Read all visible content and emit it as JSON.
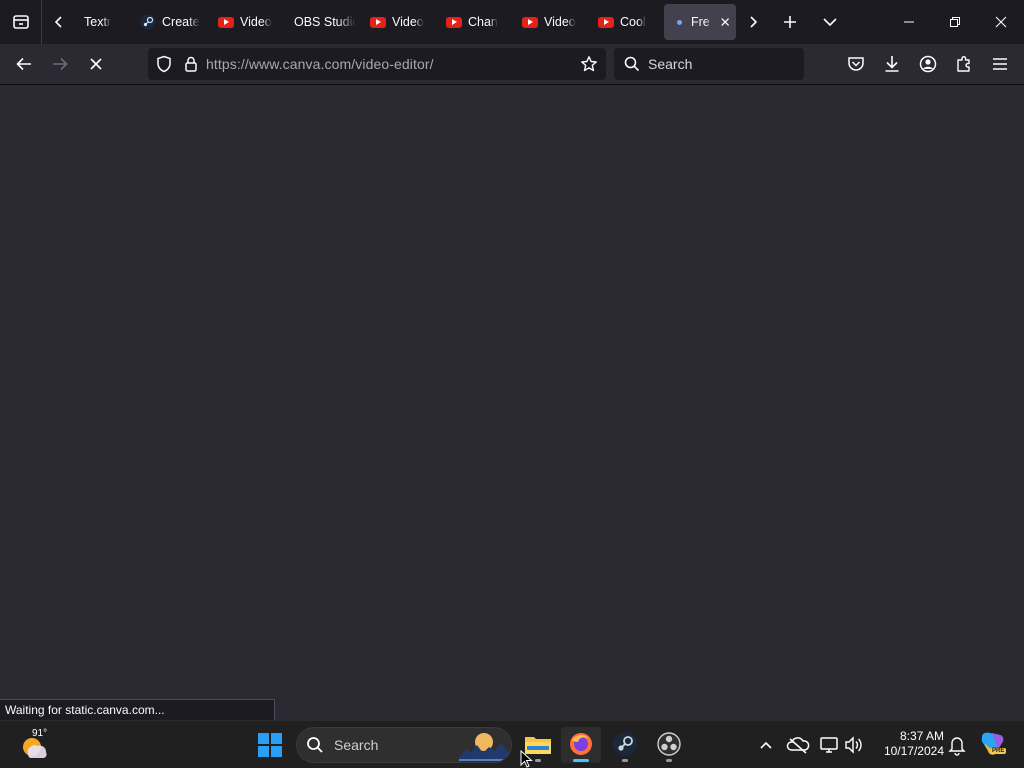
{
  "browser": {
    "tabs": [
      {
        "label": "Textr",
        "favicon": "none"
      },
      {
        "label": "Create",
        "favicon": "steam-icon"
      },
      {
        "label": "Video",
        "favicon": "youtube-icon"
      },
      {
        "label": "OBS Studio",
        "favicon": "none"
      },
      {
        "label": "Video",
        "favicon": "youtube-icon"
      },
      {
        "label": "Chan",
        "favicon": "youtube-icon"
      },
      {
        "label": "Video",
        "favicon": "youtube-icon"
      },
      {
        "label": "Cool",
        "favicon": "youtube-icon"
      },
      {
        "label": "Fre",
        "favicon": "loading-dot",
        "active": true
      }
    ],
    "url_host": "https://www.canva.com",
    "url_path": "/video-editor/",
    "search_placeholder": "Search",
    "status_text": "Waiting for static.canva.com..."
  },
  "taskbar": {
    "weather_temp": "91°",
    "search_placeholder": "Search",
    "clock_time": "8:37 AM",
    "clock_date": "10/17/2024",
    "copilot_badge": "PRE"
  },
  "colors": {
    "accent": "#0a84ff",
    "youtube": "#e62117",
    "content_bg": "#2b2a33"
  }
}
